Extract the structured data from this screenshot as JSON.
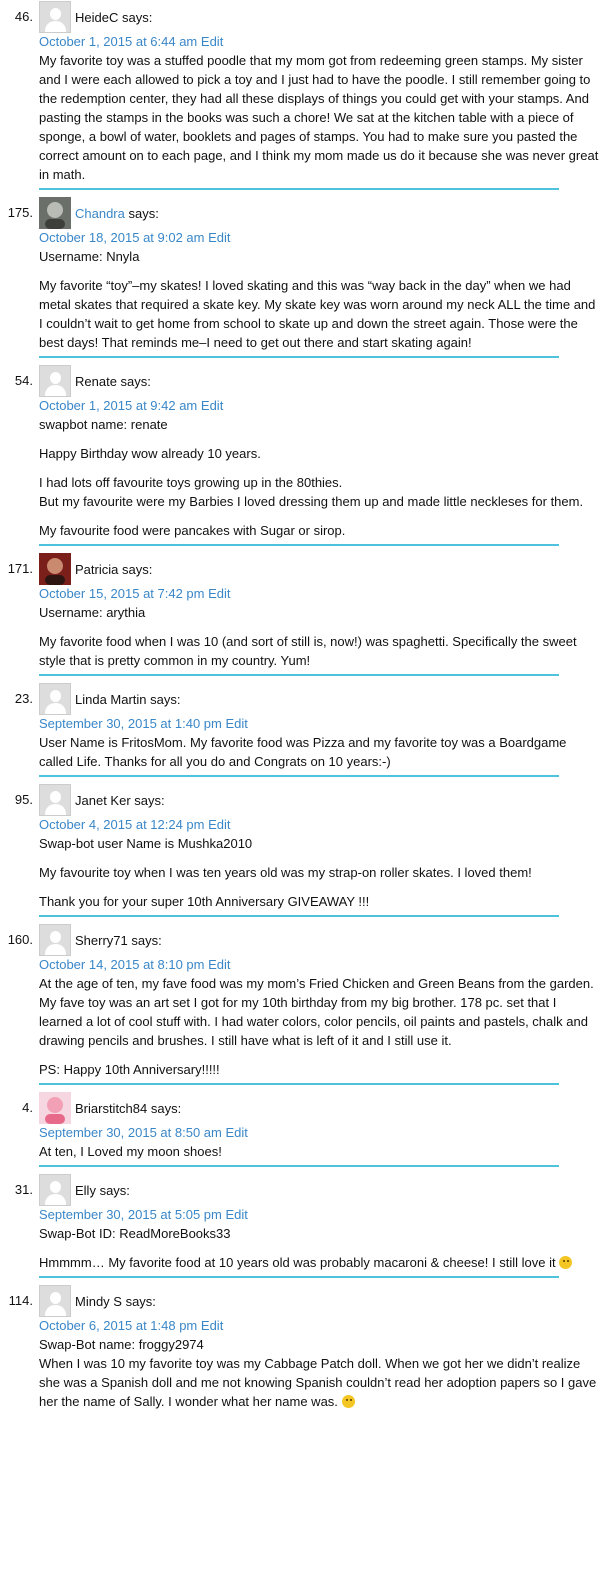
{
  "comments": [
    {
      "num": "46.",
      "author": "HeideC",
      "linked": false,
      "avatar": "default",
      "date": "October 1, 2015 at 6:44 am",
      "edit": "Edit",
      "paras": [
        "My favorite toy was a stuffed poodle that my mom got from redeeming green stamps. My sister and I were each allowed to pick a toy and I just had to have the poodle. I still remember going to the redemption center, they had all these displays of things you could get with your stamps. And pasting the stamps in the books was such a chore! We sat at the kitchen table with a piece of sponge, a bowl of water, booklets and pages of stamps. You had to make sure you pasted the correct amount on to each page, and I think my mom made us do it because she was never great in math."
      ]
    },
    {
      "num": "175.",
      "author": "Chandra",
      "linked": true,
      "avatar": "photo-grey",
      "date": "October 18, 2015 at 9:02 am",
      "edit": "Edit",
      "paras": [
        "Username: Nnyla",
        "My favorite “toy”–my skates! I loved skating and this was “way back in the day” when we had metal skates that required a skate key. My skate key was worn around my neck ALL the time and I couldn’t wait to get home from school to skate up and down the street again. Those were the best days! That reminds me–I need to get out there and start skating again!"
      ]
    },
    {
      "num": "54.",
      "author": "Renate",
      "linked": false,
      "avatar": "default",
      "date": "October 1, 2015 at 9:42 am",
      "edit": "Edit",
      "paras": [
        "swapbot name: renate",
        "Happy Birthday wow already 10 years.",
        "I had lots off favourite toys growing up in the 80thies.\nBut my favourite were my Barbies I loved dressing them up and made little neckleses for them.",
        "My favourite food were pancakes with Sugar or sirop."
      ]
    },
    {
      "num": "171.",
      "author": "Patricia",
      "linked": false,
      "avatar": "photo-red",
      "date": "October 15, 2015 at 7:42 pm",
      "edit": "Edit",
      "paras": [
        "Username: arythia",
        "My favorite food when I was 10 (and sort of still is, now!) was spaghetti. Specifically the sweet style that is pretty common in my country. Yum!"
      ]
    },
    {
      "num": "23.",
      "author": "Linda Martin",
      "linked": false,
      "avatar": "default",
      "date": "September 30, 2015 at 1:40 pm",
      "edit": "Edit",
      "paras": [
        "User Name is FritosMom. My favorite food was Pizza and my favorite toy was a Boardgame called Life. Thanks for all you do and Congrats on 10 years:-)"
      ]
    },
    {
      "num": "95.",
      "author": "Janet Ker",
      "linked": false,
      "avatar": "default",
      "date": "October 4, 2015 at 12:24 pm",
      "edit": "Edit",
      "paras": [
        "Swap-bot user Name is Mushka2010",
        "My favourite toy when I was ten years old was my strap-on roller skates. I loved them!",
        "Thank you for your super 10th Anniversary GIVEAWAY !!!"
      ]
    },
    {
      "num": "160.",
      "author": "Sherry71",
      "linked": false,
      "avatar": "default",
      "date": "October 14, 2015 at 8:10 pm",
      "edit": "Edit",
      "paras": [
        "At the age of ten, my fave food was my mom’s Fried Chicken and Green Beans from the garden. My fave toy was an art set I got for my 10th birthday from my big brother. 178 pc. set that I learned a lot of cool stuff with. I had water colors, color pencils, oil paints and pastels, chalk and drawing pencils and brushes. I still have what is left of it and I still use it.",
        "PS: Happy 10th Anniversary!!!!!"
      ]
    },
    {
      "num": "4.",
      "author": "Briarstitch84",
      "linked": false,
      "avatar": "photo-pink",
      "date": "September 30, 2015 at 8:50 am",
      "edit": "Edit",
      "paras": [
        "At ten, I Loved my moon shoes!"
      ]
    },
    {
      "num": "31.",
      "author": "Elly",
      "linked": false,
      "avatar": "default",
      "date": "September 30, 2015 at 5:05 pm",
      "edit": "Edit",
      "paras": [
        "Swap-Bot ID: ReadMoreBooks33",
        "Hmmmm… My favorite food at 10 years old was probably macaroni & cheese! I still love it"
      ],
      "smiley_last": true
    },
    {
      "num": "114.",
      "author": "Mindy S",
      "linked": false,
      "avatar": "default",
      "date": "October 6, 2015 at 1:48 pm",
      "edit": "Edit",
      "paras": [
        "Swap-Bot name: froggy2974\nWhen I was 10 my favorite toy was my Cabbage Patch doll. When we got her we didn’t realize she was a Spanish doll and me not knowing Spanish couldn’t read her adoption papers so I gave her the name of Sally. I wonder what her name was."
      ],
      "smiley_last": true
    }
  ],
  "says_label": "says:"
}
